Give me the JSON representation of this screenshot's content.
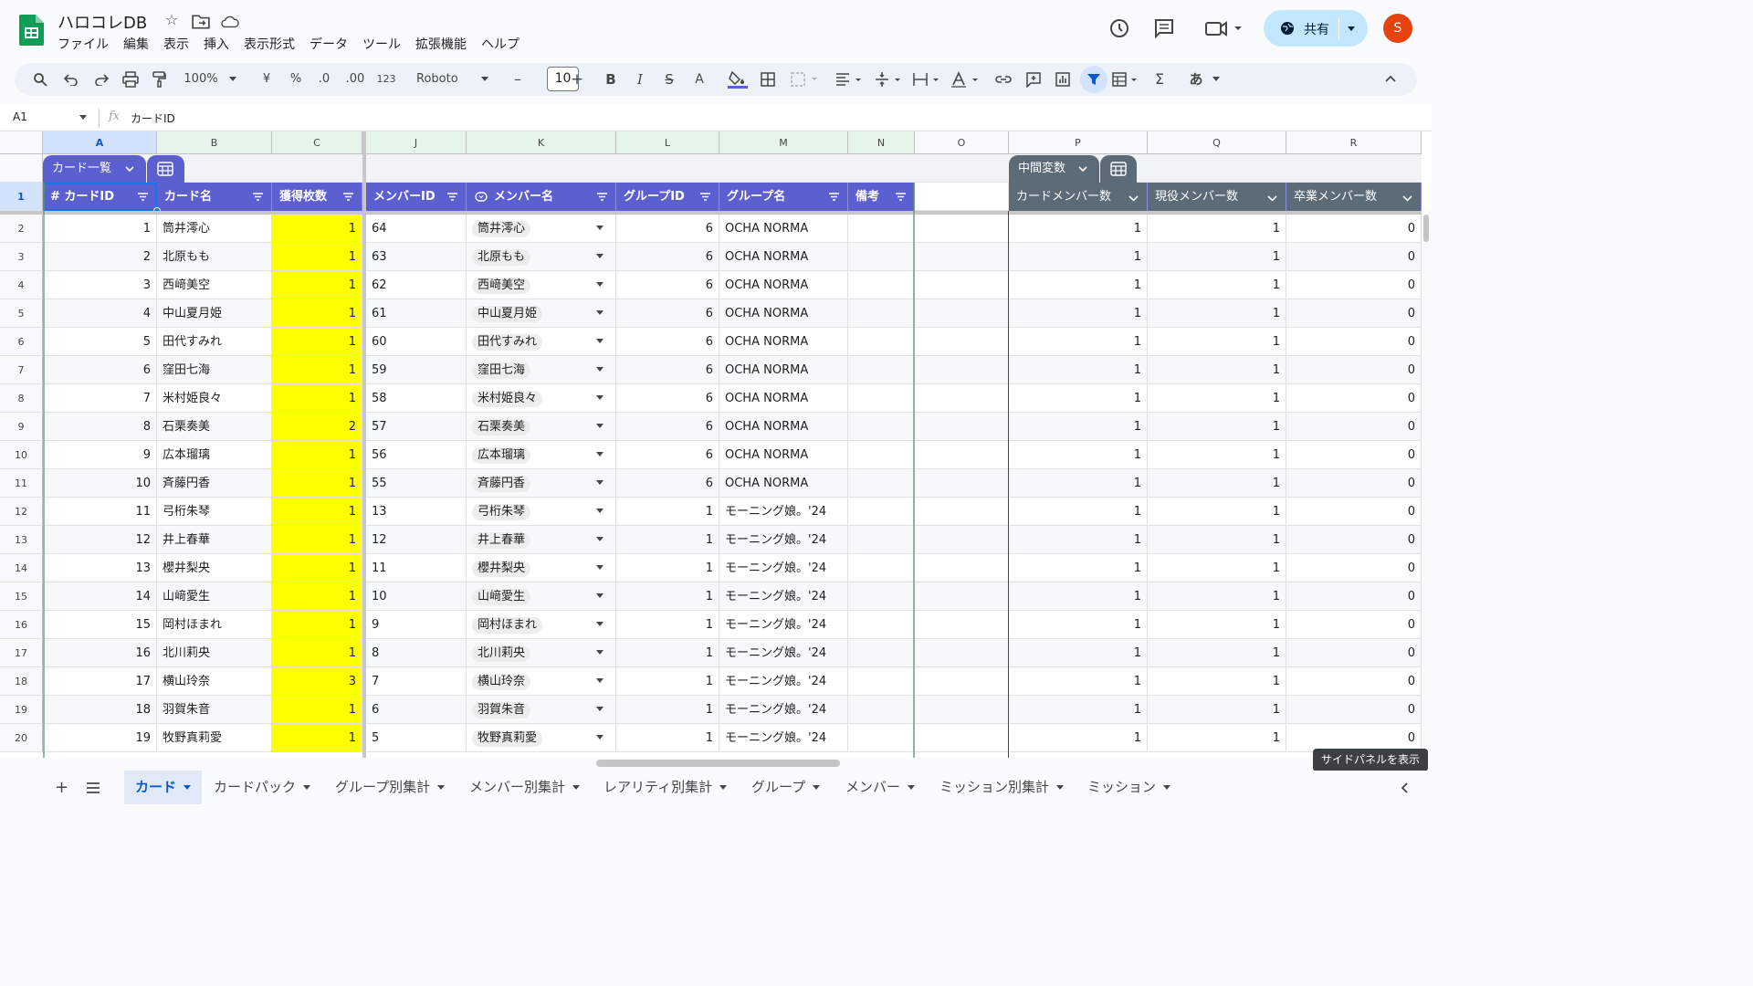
{
  "app": {
    "title": "ハロコレDB",
    "avatar_letter": "S",
    "share_label": "共有"
  },
  "menu": [
    "ファイル",
    "編集",
    "表示",
    "挿入",
    "表示形式",
    "データ",
    "ツール",
    "拡張機能",
    "ヘルプ"
  ],
  "toolbar": {
    "zoom": "100%",
    "currency": "¥",
    "percent": "%",
    "dec_minus": ".0",
    "dec_plus": ".00",
    "number_format": "123",
    "font": "Roboto",
    "font_size": "10"
  },
  "formula_bar": {
    "cell_ref": "A1",
    "fx": "fx",
    "value": "カードID"
  },
  "columns": [
    "A",
    "B",
    "C",
    "J",
    "K",
    "L",
    "M",
    "N",
    "O",
    "P",
    "Q",
    "R"
  ],
  "table_chips": {
    "left": "カード一覧",
    "right": "中間変数"
  },
  "headers": {
    "card_id": "# カードID",
    "card_name": "カード名",
    "count": "獲得枚数",
    "member_id": "メンバーID",
    "member_name": "メンバー名",
    "group_id": "グループID",
    "group_name": "グループ名",
    "note": "備考",
    "card_member_count": "カードメンバー数",
    "active_count": "現役メンバー数",
    "grad_count": "卒業メンバー数"
  },
  "rows": [
    {
      "row": "2",
      "id": "1",
      "name": "筒井澪心",
      "count": "1",
      "mid": "64",
      "mname": "筒井澪心",
      "gid": "6",
      "gname": "OCHA NORMA",
      "p": "1",
      "q": "1",
      "r": "0"
    },
    {
      "row": "3",
      "id": "2",
      "name": "北原もも",
      "count": "1",
      "mid": "63",
      "mname": "北原もも",
      "gid": "6",
      "gname": "OCHA NORMA",
      "p": "1",
      "q": "1",
      "r": "0"
    },
    {
      "row": "4",
      "id": "3",
      "name": "西﨑美空",
      "count": "1",
      "mid": "62",
      "mname": "西﨑美空",
      "gid": "6",
      "gname": "OCHA NORMA",
      "p": "1",
      "q": "1",
      "r": "0"
    },
    {
      "row": "5",
      "id": "4",
      "name": "中山夏月姫",
      "count": "1",
      "mid": "61",
      "mname": "中山夏月姫",
      "gid": "6",
      "gname": "OCHA NORMA",
      "p": "1",
      "q": "1",
      "r": "0"
    },
    {
      "row": "6",
      "id": "5",
      "name": "田代すみれ",
      "count": "1",
      "mid": "60",
      "mname": "田代すみれ",
      "gid": "6",
      "gname": "OCHA NORMA",
      "p": "1",
      "q": "1",
      "r": "0"
    },
    {
      "row": "7",
      "id": "6",
      "name": "窪田七海",
      "count": "1",
      "mid": "59",
      "mname": "窪田七海",
      "gid": "6",
      "gname": "OCHA NORMA",
      "p": "1",
      "q": "1",
      "r": "0"
    },
    {
      "row": "8",
      "id": "7",
      "name": "米村姫良々",
      "count": "1",
      "mid": "58",
      "mname": "米村姫良々",
      "gid": "6",
      "gname": "OCHA NORMA",
      "p": "1",
      "q": "1",
      "r": "0"
    },
    {
      "row": "9",
      "id": "8",
      "name": "石栗奏美",
      "count": "2",
      "mid": "57",
      "mname": "石栗奏美",
      "gid": "6",
      "gname": "OCHA NORMA",
      "p": "1",
      "q": "1",
      "r": "0"
    },
    {
      "row": "10",
      "id": "9",
      "name": "広本瑠璃",
      "count": "1",
      "mid": "56",
      "mname": "広本瑠璃",
      "gid": "6",
      "gname": "OCHA NORMA",
      "p": "1",
      "q": "1",
      "r": "0"
    },
    {
      "row": "11",
      "id": "10",
      "name": "斉藤円香",
      "count": "1",
      "mid": "55",
      "mname": "斉藤円香",
      "gid": "6",
      "gname": "OCHA NORMA",
      "p": "1",
      "q": "1",
      "r": "0"
    },
    {
      "row": "12",
      "id": "11",
      "name": "弓桁朱琴",
      "count": "1",
      "mid": "13",
      "mname": "弓桁朱琴",
      "gid": "1",
      "gname": "モーニング娘。'24",
      "p": "1",
      "q": "1",
      "r": "0"
    },
    {
      "row": "13",
      "id": "12",
      "name": "井上春華",
      "count": "1",
      "mid": "12",
      "mname": "井上春華",
      "gid": "1",
      "gname": "モーニング娘。'24",
      "p": "1",
      "q": "1",
      "r": "0"
    },
    {
      "row": "14",
      "id": "13",
      "name": "櫻井梨央",
      "count": "1",
      "mid": "11",
      "mname": "櫻井梨央",
      "gid": "1",
      "gname": "モーニング娘。'24",
      "p": "1",
      "q": "1",
      "r": "0"
    },
    {
      "row": "15",
      "id": "14",
      "name": "山﨑愛生",
      "count": "1",
      "mid": "10",
      "mname": "山﨑愛生",
      "gid": "1",
      "gname": "モーニング娘。'24",
      "p": "1",
      "q": "1",
      "r": "0"
    },
    {
      "row": "16",
      "id": "15",
      "name": "岡村ほまれ",
      "count": "1",
      "mid": "9",
      "mname": "岡村ほまれ",
      "gid": "1",
      "gname": "モーニング娘。'24",
      "p": "1",
      "q": "1",
      "r": "0"
    },
    {
      "row": "17",
      "id": "16",
      "name": "北川莉央",
      "count": "1",
      "mid": "8",
      "mname": "北川莉央",
      "gid": "1",
      "gname": "モーニング娘。'24",
      "p": "1",
      "q": "1",
      "r": "0"
    },
    {
      "row": "18",
      "id": "17",
      "name": "横山玲奈",
      "count": "3",
      "mid": "7",
      "mname": "横山玲奈",
      "gid": "1",
      "gname": "モーニング娘。'24",
      "p": "1",
      "q": "1",
      "r": "0"
    },
    {
      "row": "19",
      "id": "18",
      "name": "羽賀朱音",
      "count": "1",
      "mid": "6",
      "mname": "羽賀朱音",
      "gid": "1",
      "gname": "モーニング娘。'24",
      "p": "1",
      "q": "1",
      "r": "0"
    },
    {
      "row": "20",
      "id": "19",
      "name": "牧野真莉愛",
      "count": "1",
      "mid": "5",
      "mname": "牧野真莉愛",
      "gid": "1",
      "gname": "モーニング娘。'24",
      "p": "1",
      "q": "1",
      "r": "0"
    }
  ],
  "sheet_tabs": [
    "カード",
    "カードパック",
    "グループ別集計",
    "メンバー別集計",
    "レアリティ別集計",
    "グループ",
    "メンバー",
    "ミッション別集計",
    "ミッション"
  ],
  "tooltip": "サイドパネルを表示",
  "colors": {
    "header_blue": "#5c5fd0",
    "header_gray": "#5b6b78",
    "highlight": "#ffff00",
    "accent": "#0b57d0"
  }
}
